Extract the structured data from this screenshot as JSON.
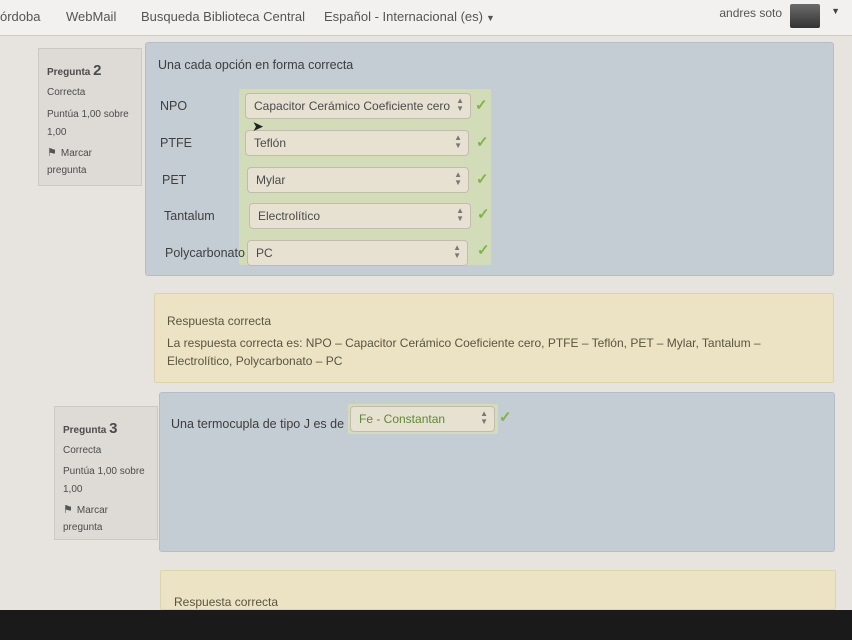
{
  "topbar": {
    "nav": [
      "órdoba",
      "WebMail",
      "Busqueda Biblioteca Central",
      "Español - Internacional (es)"
    ],
    "user_name": "andres soto"
  },
  "q2": {
    "info": {
      "label": "Pregunta",
      "number": "2",
      "state": "Correcta",
      "grade_line1": "Puntúa 1,00 sobre",
      "grade_line2": "1,00",
      "flag_line1": "Marcar",
      "flag_line2": "pregunta"
    },
    "prompt": "Una cada opción en forma correcta",
    "rows": [
      {
        "label": "NPO",
        "selected": "Capacitor Cerámico Coeficiente cero"
      },
      {
        "label": "PTFE",
        "selected": "Teflón"
      },
      {
        "label": "PET",
        "selected": "Mylar"
      },
      {
        "label": "Tantalum",
        "selected": "Electrolítico"
      },
      {
        "label": "Polycarbonato",
        "selected": "PC"
      }
    ],
    "feedback": {
      "title": "Respuesta correcta",
      "line1": "La respuesta correcta es: NPO – Capacitor Cerámico Coeficiente cero, PTFE – Teflón, PET – Mylar, Tantalum –",
      "line2": "Electrolítico, Polycarbonato – PC"
    }
  },
  "q3": {
    "info": {
      "label": "Pregunta",
      "number": "3",
      "state": "Correcta",
      "grade_line1": "Puntúa 1,00 sobre",
      "grade_line2": "1,00",
      "flag_line1": "Marcar",
      "flag_line2": "pregunta"
    },
    "prompt": "Una termocupla de tipo J es de :",
    "selected": "Fe - Constantan",
    "feedback_title": "Respuesta correcta"
  },
  "icons": {
    "correct": "check-icon",
    "flag": "flag-icon",
    "select_arrows": "updown-arrows-icon"
  },
  "colors": {
    "correct_green": "#7fb446",
    "formulation_bg": "#c4ccd4",
    "feedback_bg": "#ebe3c4"
  }
}
